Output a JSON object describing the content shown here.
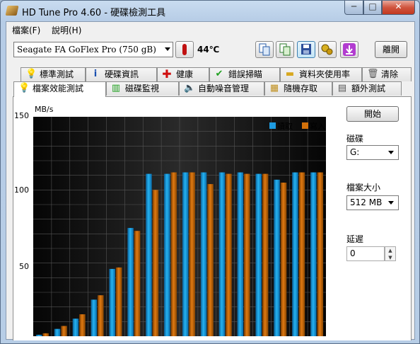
{
  "window": {
    "title": "HD Tune Pro 4.60 - 硬碟檢測工具",
    "min_label": "─",
    "max_label": "□",
    "close_label": "✕"
  },
  "menu": {
    "items": [
      "檔案(F)",
      "說明(H)"
    ]
  },
  "toolbar": {
    "drive": "Seagate FA GoFlex Pro    (750 gB)",
    "temperature": "44℃",
    "exit_label": "離開",
    "icons": [
      "copy-info-icon",
      "copy-screen-icon",
      "save-icon",
      "options-icon",
      "download-icon"
    ]
  },
  "tabs": {
    "top_row": [
      "標準測試",
      "硬碟資訊",
      "健康",
      "錯誤掃瞄",
      "資料夾使用率",
      "清除"
    ],
    "bottom_row": [
      "檔案效能測試",
      "磁碟監視",
      "自動噪音管理",
      "隨機存取",
      "額外測試"
    ],
    "active": "檔案效能測試"
  },
  "side": {
    "start_label": "開始",
    "drive_label": "磁碟",
    "drive_value": "G:",
    "size_label": "檔案大小",
    "size_value": "512 MB",
    "delay_label": "延遲",
    "delay_value": "0"
  },
  "chart_data": {
    "type": "bar",
    "ylabel": "MB/s",
    "ylim": [
      0,
      150
    ],
    "yticks": [
      50,
      100,
      150
    ],
    "grid": true,
    "legend_position": "top-right",
    "colors": {
      "read": "#1e9be0",
      "write": "#d2700a",
      "background": "#1a1a1a"
    },
    "series": [
      {
        "name": "讀取",
        "values": [
          1,
          5,
          12,
          25,
          46,
          74,
          111,
          111,
          112,
          112,
          112,
          112,
          111,
          107,
          112,
          112
        ]
      },
      {
        "name": "寫入",
        "values": [
          2,
          7,
          15,
          28,
          47,
          72,
          100,
          112,
          112,
          104,
          111,
          111,
          111,
          105,
          112,
          112
        ]
      }
    ]
  }
}
